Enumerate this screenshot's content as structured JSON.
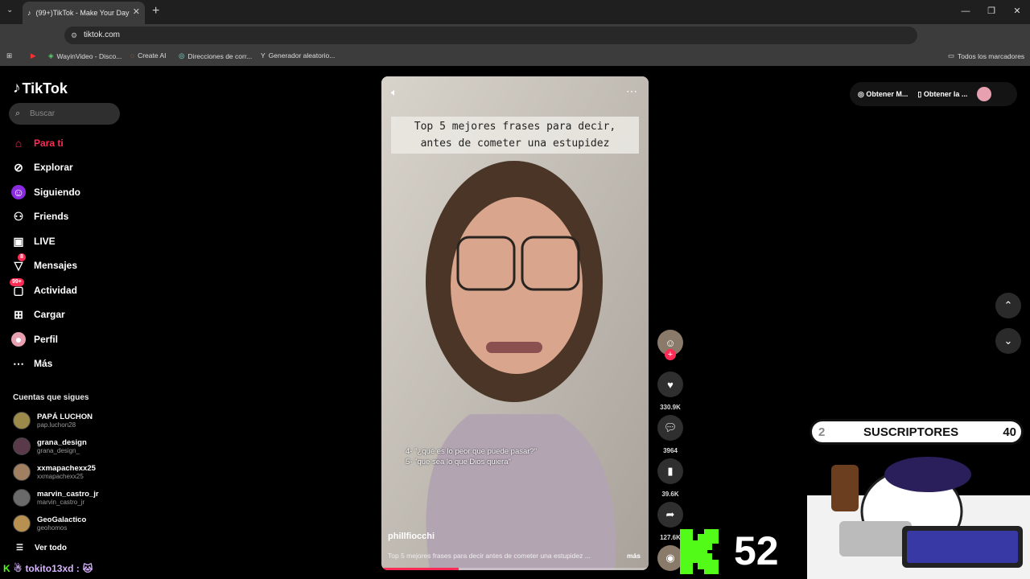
{
  "browser": {
    "tab_title": "(99+)TikTok - Make Your Day",
    "url": "tiktok.com",
    "bookmarks": [
      "WayinVideo - Disco...",
      "Create AI",
      "Direcciones de corr...",
      "Generador aleatorio..."
    ],
    "all_bookmarks": "Todos los marcadores"
  },
  "sidebar": {
    "logo": "TikTok",
    "search_placeholder": "Buscar",
    "items": [
      {
        "label": "Para ti"
      },
      {
        "label": "Explorar"
      },
      {
        "label": "Siguiendo"
      },
      {
        "label": "Friends"
      },
      {
        "label": "LIVE"
      },
      {
        "label": "Mensajes",
        "badge": "8"
      },
      {
        "label": "Actividad",
        "badge": "99+"
      },
      {
        "label": "Cargar"
      },
      {
        "label": "Perfil"
      },
      {
        "label": "Más"
      }
    ],
    "following_title": "Cuentas que sigues",
    "accounts": [
      {
        "name": "PAPÁ LUCHON",
        "handle": "pap.luchon28"
      },
      {
        "name": "grana_design",
        "handle": "grana_design_"
      },
      {
        "name": "xxmapachexx25",
        "handle": "xxmapachexx25"
      },
      {
        "name": "marvin_castro_jr",
        "handle": "marvin_castro_jr"
      },
      {
        "name": "GeoGalactico",
        "handle": "geohomos"
      }
    ],
    "see_all": "Ver todo"
  },
  "video": {
    "caption_line1": "Top 5 mejores frases para decir,",
    "caption_line2": "antes de cometer una estupidez",
    "subtitle_line1": "4- \"¿qué es lo peor que puede pasar?\"",
    "subtitle_line2": "5- \"que sea lo que Dios quiera\"",
    "author": "phillfiocchi",
    "description": "Top 5 mejores frases para decir antes de cometer una estupidez ...",
    "more": "más",
    "progress": 0.29
  },
  "actions": {
    "likes": "330.9K",
    "comments": "3964",
    "saves": "39.6K",
    "shares": "127.6K"
  },
  "topright": {
    "get_m": "Obtener M...",
    "get_la": "Obtener la ..."
  },
  "overlay": {
    "subs_label": "SUSCRIPTORES",
    "subs_left": "2",
    "subs_right": "40",
    "kick_count": "52",
    "chat_user": "tokito13xd :",
    "kick_color": "#53fc18"
  }
}
